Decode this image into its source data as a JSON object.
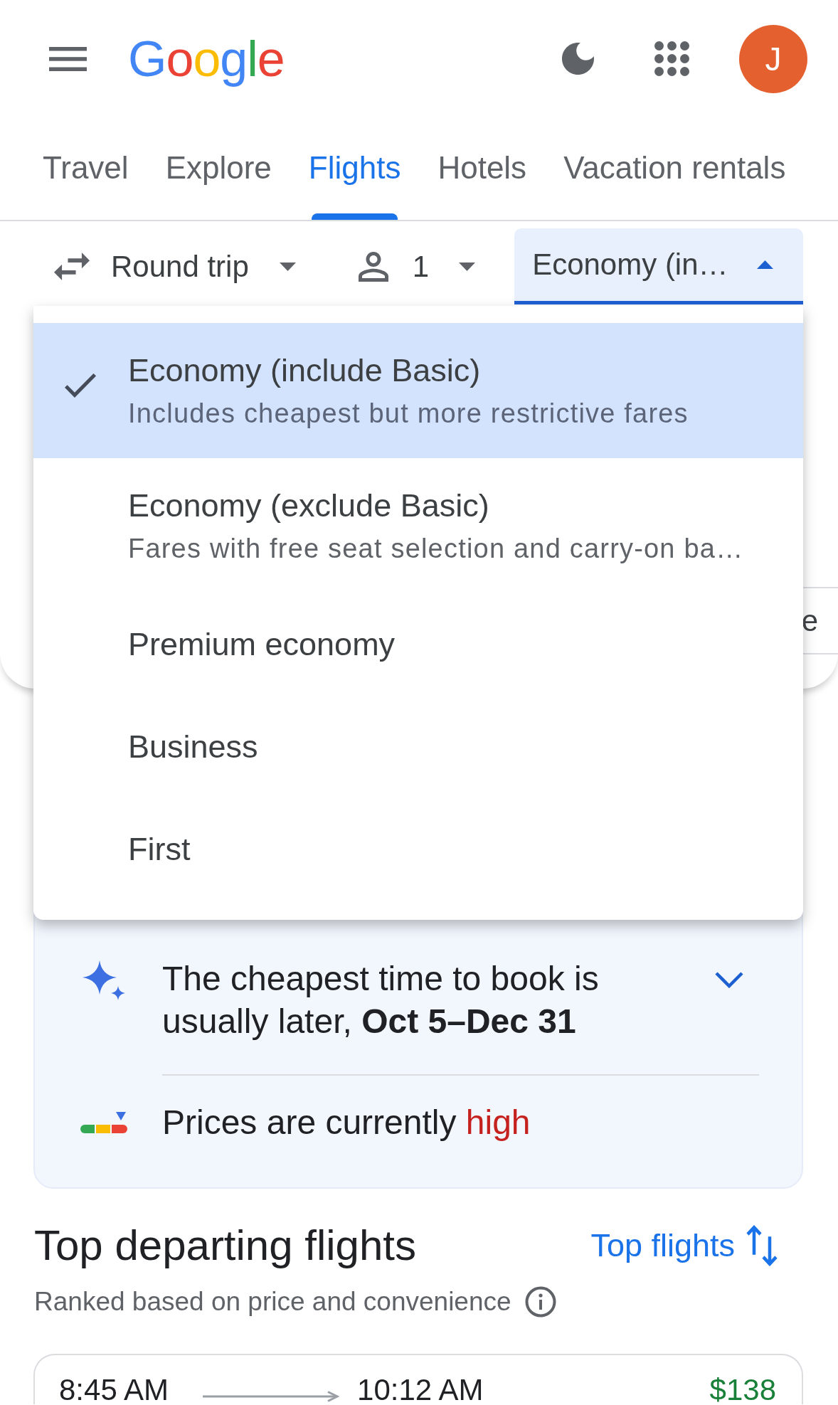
{
  "header": {
    "logo": "Google",
    "avatar_initial": "J"
  },
  "tabs": [
    {
      "label": "Travel",
      "selected": false
    },
    {
      "label": "Explore",
      "selected": false
    },
    {
      "label": "Flights",
      "selected": true
    },
    {
      "label": "Hotels",
      "selected": false
    },
    {
      "label": "Vacation rentals",
      "selected": false
    }
  ],
  "filters": [
    {
      "kind": "trip_type",
      "label": "Round trip",
      "expanded": false
    },
    {
      "kind": "passengers",
      "label": "1",
      "expanded": false
    },
    {
      "kind": "cabin_class",
      "label": "Economy (in…",
      "expanded": true
    }
  ],
  "search_form": {
    "partial_field": {
      "value": "e"
    }
  },
  "cabin_menu": {
    "options": [
      {
        "title": "Economy (include Basic)",
        "description": "Includes cheapest but more restrictive fares",
        "selected": true
      },
      {
        "title": "Economy (exclude Basic)",
        "description": "Fares with free seat selection and carry-on ba…",
        "selected": false
      },
      {
        "title": "Premium economy",
        "selected": false
      },
      {
        "title": "Business",
        "selected": false
      },
      {
        "title": "First",
        "selected": false
      }
    ]
  },
  "booking_tip": {
    "text": "The cheapest time to book is usually later, **Oct 5–Dec 31**",
    "expanded": false
  },
  "price_status": {
    "text": "Prices are currently",
    "level_word": "high"
  },
  "results": {
    "title": "Top departing flights",
    "sort_label": "Top flights",
    "subtitle": "Ranked based on price and convenience",
    "flights": [
      {
        "depart": "8:45 AM",
        "arrive": "10:12 AM",
        "price": "$138"
      }
    ]
  }
}
